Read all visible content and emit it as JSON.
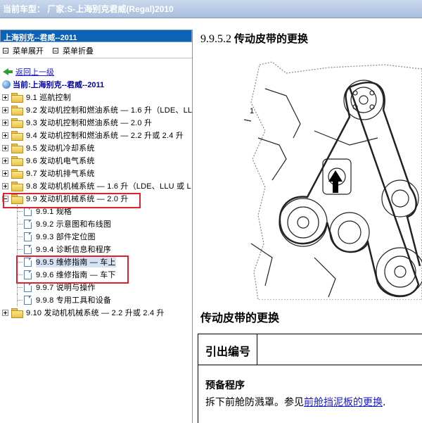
{
  "window": {
    "title_prefix": "当前车型：",
    "title_value": "厂家:S-上海别克君威(Regal)2010"
  },
  "sidebar": {
    "header": "上海别克--君威--2011",
    "expand_label": "菜单展开",
    "collapse_label": "菜单折叠",
    "back_label": "返回上一级",
    "current_label": "当前:上海别克--君威--2011",
    "items": [
      {
        "label": "9.1 巡航控制",
        "type": "folder",
        "expanded": false
      },
      {
        "label": "9.2 发动机控制和燃油系统 — 1.6 升（LDE、LL",
        "type": "folder",
        "expanded": false
      },
      {
        "label": "9.3 发动机控制和燃油系统 — 2.0 升",
        "type": "folder",
        "expanded": false
      },
      {
        "label": "9.4 发动机控制和燃油系统 — 2.2 升或 2.4 升",
        "type": "folder",
        "expanded": false
      },
      {
        "label": "9.5 发动机冷却系统",
        "type": "folder",
        "expanded": false
      },
      {
        "label": "9.6 发动机电气系统",
        "type": "folder",
        "expanded": false
      },
      {
        "label": "9.7 发动机排气系统",
        "type": "folder",
        "expanded": false
      },
      {
        "label": "9.8 发动机机械系统 — 1.6 升（LDE、LLU 或 L",
        "type": "folder",
        "expanded": false
      },
      {
        "label": "9.9 发动机机械系统 — 2.0 升",
        "type": "folder",
        "expanded": true
      },
      {
        "label": "9.9.1 规格",
        "type": "doc"
      },
      {
        "label": "9.9.2 示意图和布线图",
        "type": "doc"
      },
      {
        "label": "9.9.3 部件定位图",
        "type": "doc"
      },
      {
        "label": "9.9.4 诊断信息和程序",
        "type": "doc"
      },
      {
        "label": "9.9.5 维修指南 — 车上",
        "type": "doc",
        "selected": true
      },
      {
        "label": "9.9.6 维修指南 — 车下",
        "type": "doc"
      },
      {
        "label": "9.9.7 说明与操作",
        "type": "doc"
      },
      {
        "label": "9.9.8 专用工具和设备",
        "type": "doc"
      },
      {
        "label": "9.10 发动机机械系统 — 2.2 升或 2.4 升",
        "type": "folder",
        "expanded": false
      }
    ]
  },
  "content": {
    "section_number": "9.9.5.2",
    "section_title": "传动皮带的更换",
    "callout_number": "1",
    "heading": "传动皮带的更换",
    "table_header": "引出编号",
    "prep_title": "预备程序",
    "prep_text": "拆下前舱防溅罩。参见",
    "prep_link": "前舱挡泥板的更换",
    "prep_suffix": "."
  },
  "colors": {
    "sidebar_header_bg": "#0a63b5",
    "highlight_box": "#e0202a",
    "link": "#1a1ad4"
  }
}
